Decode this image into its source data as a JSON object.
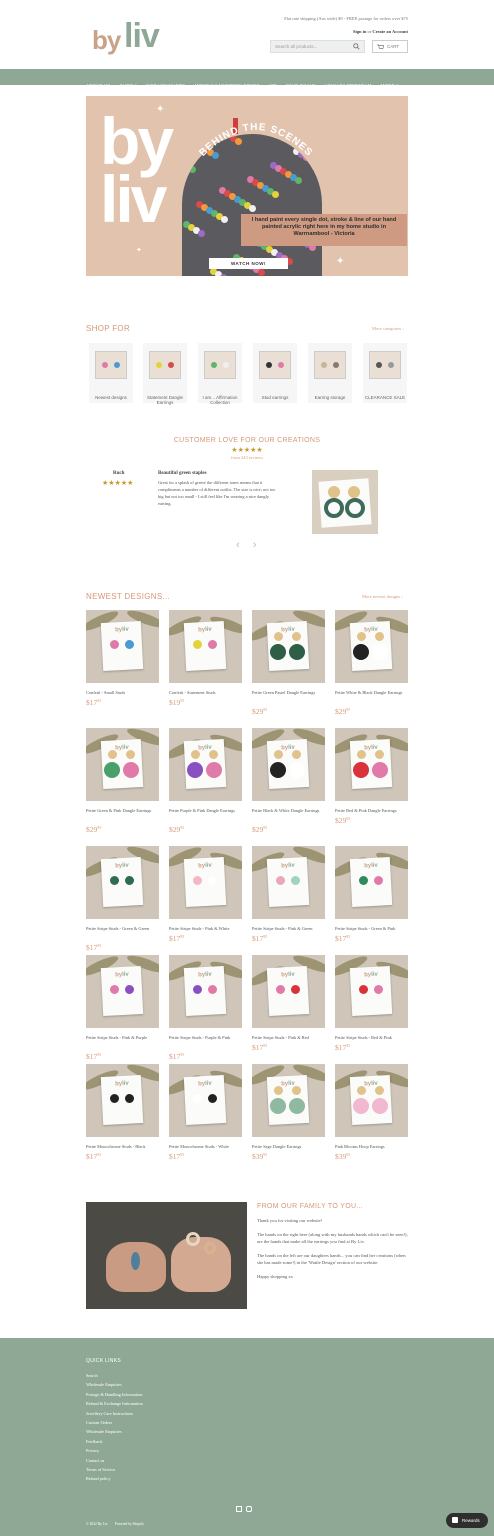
{
  "header": {
    "logo_b": "by",
    "logo_l": "liv",
    "promo": "Flat rate shipping (Aus wide) $9 - FREE postage for orders over $75",
    "sign_in": "Sign in",
    "or": "or",
    "create_account": "Create an Account",
    "search_placeholder": "Search all products...",
    "cart_label": "CART"
  },
  "nav": [
    "ABOUT US",
    "SHOP ▾",
    "GIFT VOUCHERS",
    "MONTHLY MYSTERY BOXES",
    "VIP",
    "WHOLESALE",
    "LOYALTY PROGRAM",
    "MORE ▾"
  ],
  "hero": {
    "big_by": "by",
    "big_liv": "liv",
    "behind": "BEHIND THE SCENES",
    "caption": "I hand paint every single dot, stroke & line of our hand painted acrylic right here in my home studio in Warrnambool - Victoria",
    "watch": "WATCH NOW!"
  },
  "shop_for": {
    "title": "SHOP FOR",
    "more": "More categories ›",
    "categories": [
      {
        "label": "Newest designs"
      },
      {
        "label": "Statement Dangle Earrings"
      },
      {
        "label": "I am... Affirmation Collection"
      },
      {
        "label": "Stud earrings"
      },
      {
        "label": "Earring storage"
      },
      {
        "label": "CLEARANCE SALE"
      }
    ]
  },
  "reviews": {
    "title": "CUSTOMER LOVE FOR OUR CREATIONS",
    "stars": "★★★★★",
    "count": "from 343 reviews",
    "name": "Ruch",
    "user_stars": "★★★★★",
    "headline": "Beautiful green staples",
    "body": "Great for a splash of green/ the different tones means that it compliments a number of different outfits. The size is nice; not too big but not too small - I still feel like I'm wearing a nice dangly earring.",
    "arrows": "‹ ›"
  },
  "newest": {
    "title": "NEWEST DESIGNS...",
    "more": "More newest designs ›",
    "products": [
      {
        "name": "Confetti - Small Studs",
        "price": "$17",
        "cents": "95"
      },
      {
        "name": "Confetti - Statement Studs",
        "price": "$19",
        "cents": "95"
      },
      {
        "name": "Petite Green Pastel Dangle Earrings",
        "price": "$29",
        "cents": "95"
      },
      {
        "name": "Petite White & Black Dangle Earrings",
        "price": "$29",
        "cents": "95"
      },
      {
        "name": "Petite Green & Pink Dangle Earrings",
        "price": "$29",
        "cents": "95"
      },
      {
        "name": "Petite Purple & Pink Dangle Earrings",
        "price": "$29",
        "cents": "95"
      },
      {
        "name": "Petite Black & White Dangle Earrings",
        "price": "$29",
        "cents": "95"
      },
      {
        "name": "Petite Red & Pink Dangle Earrings",
        "price": "$29",
        "cents": "95"
      },
      {
        "name": "Petite Stripe Studs - Green & Green",
        "price": "$17",
        "cents": "95"
      },
      {
        "name": "Petite Stripe Studs - Pink & White",
        "price": "$17",
        "cents": "95"
      },
      {
        "name": "Petite Stripe Studs - Pink & Green",
        "price": "$17",
        "cents": "95"
      },
      {
        "name": "Petite Stripe Studs - Green & Pink",
        "price": "$17",
        "cents": "95"
      },
      {
        "name": "Petite Stripe Studs - Pink & Purple",
        "price": "$17",
        "cents": "95"
      },
      {
        "name": "Petite Stripe Studs - Purple & Pink",
        "price": "$17",
        "cents": "95"
      },
      {
        "name": "Petite Stripe Studs - Pink & Red",
        "price": "$17",
        "cents": "95"
      },
      {
        "name": "Petite Stripe Studs - Red & Pink",
        "price": "$17",
        "cents": "95"
      },
      {
        "name": "Petite Monochrome Studs - Black",
        "price": "$17",
        "cents": "95"
      },
      {
        "name": "Petite Monochrome Studs - White",
        "price": "$17",
        "cents": "95"
      },
      {
        "name": "Petite Sage Dangle Earrings",
        "price": "$39",
        "cents": "95"
      },
      {
        "name": "Pink Blooms Hoop Earrings",
        "price": "$39",
        "cents": "95"
      }
    ]
  },
  "family": {
    "title": "FROM OUR FAMILY TO YOU...",
    "p1": "Thank you for visiting our website!",
    "p2": "The hands on the right here (along with my husbands hands which can't be seen!), are the hands that make all the earrings you find at By Liv.",
    "p3": "The hands on the left are our daughters hands... you can find her creations (when she has made some!) in the 'Wattle Design' section of our website.",
    "p4": "Happy shopping xx"
  },
  "footer": {
    "quick_links_title": "QUICK LINKS",
    "links": [
      "Search",
      "Wholesale Enquiries",
      "Postage & Handling Information",
      "Refund & Exchange Information",
      "Jewellery Care Instructions",
      "Custom Orders",
      "Wholesale Enquiries",
      "Feedback",
      "Privacy",
      "Contact us",
      "Terms of Service",
      "Refund policy"
    ],
    "copyright": "© 2022 By Liv",
    "powered": "Powered by Shopify"
  },
  "rewards": "Rewards",
  "colors": {
    "sage": "#8fa896",
    "peach": "#d6997a",
    "hero_bg": "#e2c4ae"
  }
}
